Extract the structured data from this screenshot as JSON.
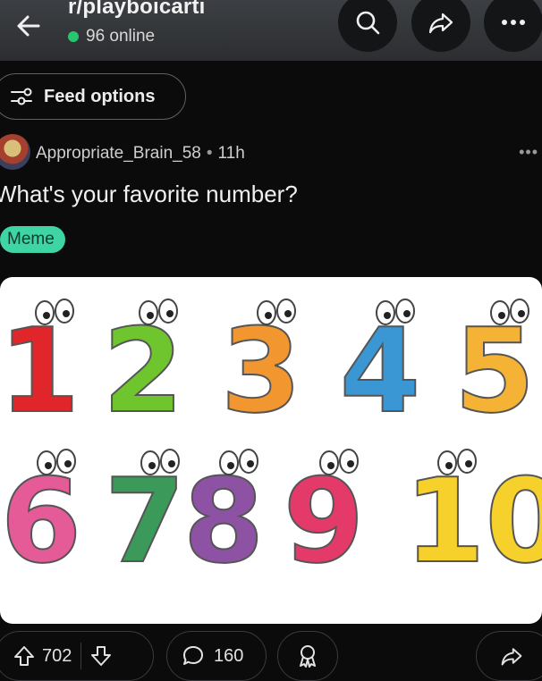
{
  "header": {
    "subreddit": "r/playboicarti",
    "online_count": "96 online",
    "online_color": "#28c76f"
  },
  "feed_options": {
    "label": "Feed options"
  },
  "post": {
    "author": "Appropriate_Brain_58",
    "separator": "•",
    "age": "11h",
    "more": "•••",
    "title": "What's your favorite number?",
    "flair": {
      "label": "Meme",
      "color": "#3fd4a3"
    },
    "image": {
      "digits": [
        "1",
        "2",
        "3",
        "4",
        "5",
        "6",
        "7",
        "8",
        "9",
        "10"
      ],
      "digit_colors": [
        "#e0262a",
        "#6fc52e",
        "#f2962f",
        "#3a97d4",
        "#f5b335",
        "#e45b98",
        "#3b9a5a",
        "#8d52a3",
        "#e33a6a",
        "#f6d12c"
      ]
    }
  },
  "actions": {
    "upvotes": "702",
    "comments": "160"
  },
  "icons": [
    "back-arrow-icon",
    "search-icon",
    "share-icon",
    "more-icon",
    "feed-options-icon",
    "upvote-icon",
    "downvote-icon",
    "comment-icon",
    "award-icon"
  ]
}
